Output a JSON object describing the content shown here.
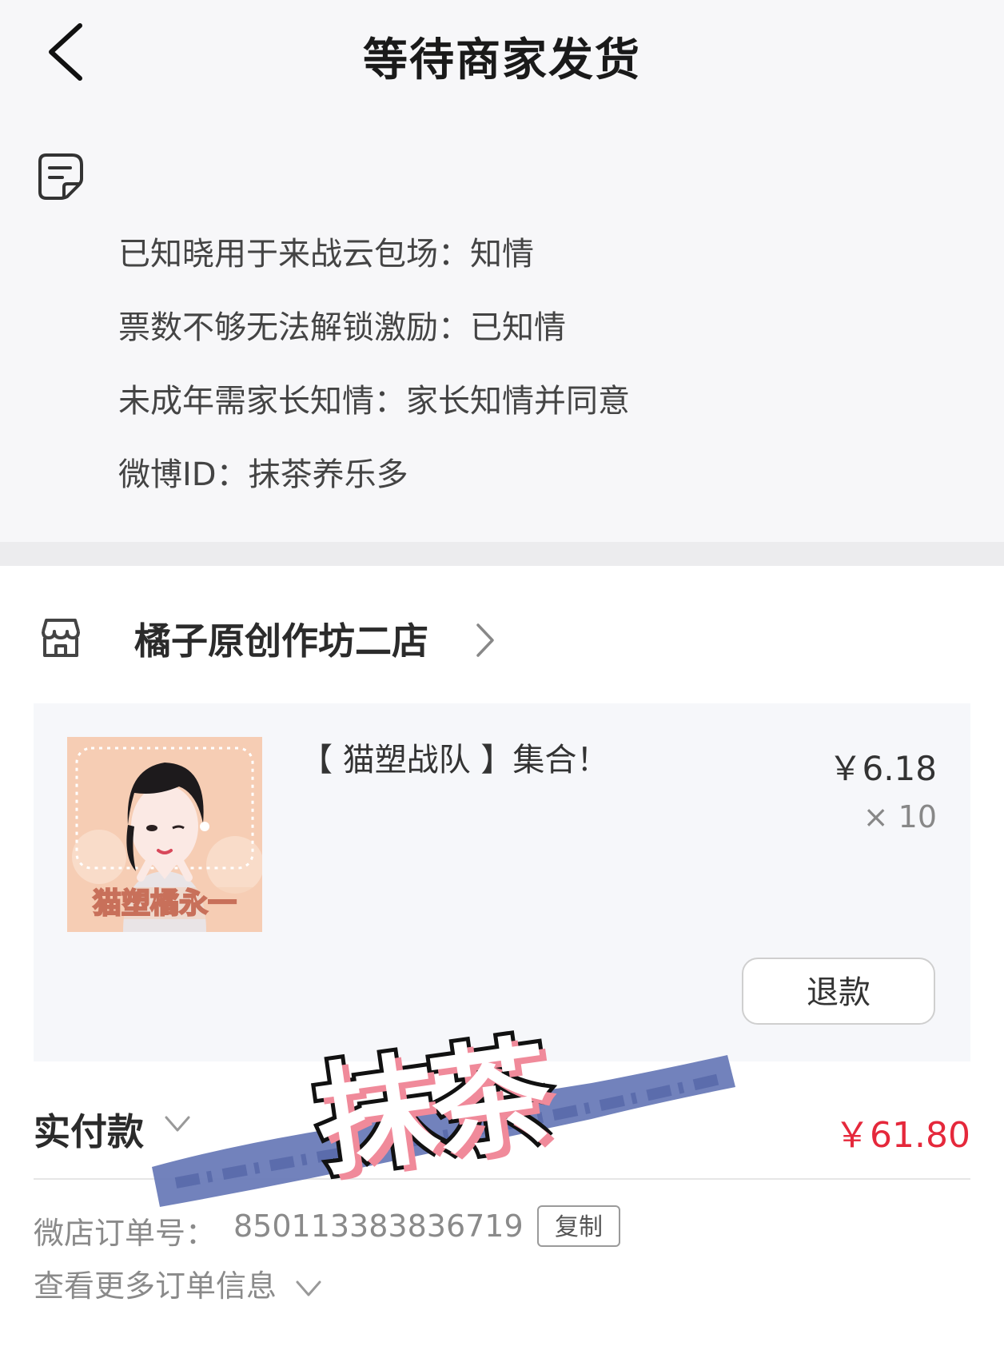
{
  "header": {
    "title": "等待商家发货"
  },
  "notes": [
    "已知晓用于来战云包场：知情",
    "票数不够无法解锁激励：已知情",
    "未成年需家长知情：家长知情并同意",
    "微博ID：抹茶养乐多"
  ],
  "shop": {
    "name": "橘子原创作坊二店"
  },
  "product": {
    "title": "【 猫塑战队 】集合！",
    "price": "￥6.18",
    "quantity": "× 10",
    "image_caption": "猫塑橘永一",
    "refund_label": "退款"
  },
  "payment": {
    "label": "实付款",
    "amount": "￥61.80"
  },
  "order": {
    "label": "微店订单号：",
    "number": "850113383836719",
    "copy_label": "复制",
    "more_info_label": "查看更多订单信息"
  },
  "watermark": {
    "text": "抹茶"
  },
  "colors": {
    "accent_red": "#e5283b",
    "background": "#f7f7f9",
    "watermark_stroke": "#6a7bb8"
  }
}
